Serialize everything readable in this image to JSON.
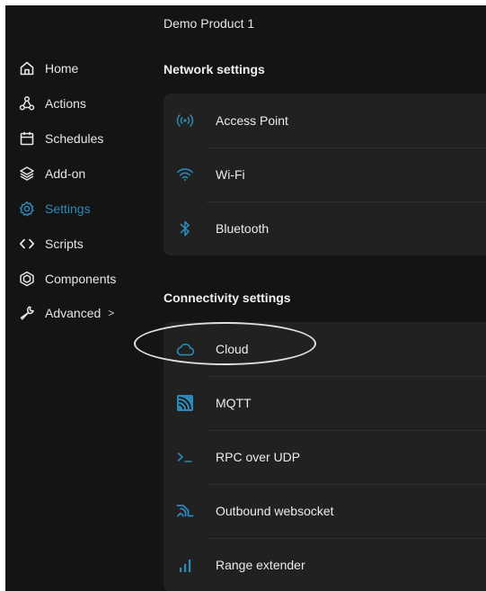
{
  "header": {
    "product_name": "Demo Product 1"
  },
  "sidebar": {
    "items": [
      {
        "label": "Home",
        "icon": "home-icon"
      },
      {
        "label": "Actions",
        "icon": "actions-icon"
      },
      {
        "label": "Schedules",
        "icon": "calendar-icon"
      },
      {
        "label": "Add-on",
        "icon": "layers-icon"
      },
      {
        "label": "Settings",
        "icon": "gear-icon",
        "active": true
      },
      {
        "label": "Scripts",
        "icon": "code-icon"
      },
      {
        "label": "Components",
        "icon": "components-icon"
      },
      {
        "label": "Advanced",
        "icon": "wrench-icon",
        "chevron": ">"
      }
    ]
  },
  "network_settings": {
    "title": "Network settings",
    "items": [
      {
        "label": "Access Point",
        "icon": "access-point-icon"
      },
      {
        "label": "Wi-Fi",
        "icon": "wifi-icon"
      },
      {
        "label": "Bluetooth",
        "icon": "bluetooth-icon"
      }
    ]
  },
  "connectivity_settings": {
    "title": "Connectivity settings",
    "items": [
      {
        "label": "Cloud",
        "icon": "cloud-icon",
        "highlighted": true
      },
      {
        "label": "MQTT",
        "icon": "mqtt-icon"
      },
      {
        "label": "RPC over UDP",
        "icon": "terminal-icon"
      },
      {
        "label": "Outbound websocket",
        "icon": "websocket-icon"
      },
      {
        "label": "Range extender",
        "icon": "signal-bars-icon"
      }
    ]
  },
  "colors": {
    "background": "#141414",
    "card": "#212121",
    "accent": "#2a8ab8",
    "text": "#e8e8e8"
  }
}
